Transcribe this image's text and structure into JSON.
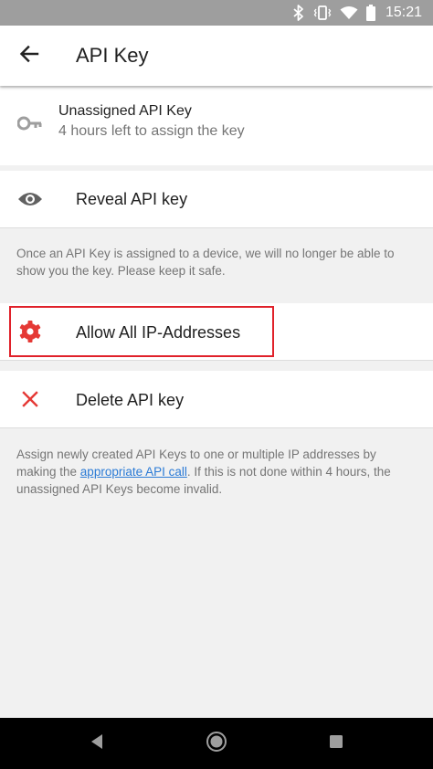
{
  "status_bar": {
    "time": "15:21",
    "icons": [
      "bluetooth-icon",
      "vibrate-icon",
      "wifi-icon",
      "battery-icon"
    ]
  },
  "app_bar": {
    "title": "API Key",
    "back_icon": "arrow-back-icon"
  },
  "key_info": {
    "title": "Unassigned API Key",
    "subtitle": "4 hours left to assign the key",
    "icon": "key-icon"
  },
  "reveal": {
    "label": "Reveal API key",
    "icon": "eye-icon"
  },
  "reveal_note": "Once an API Key is assigned to a device, we will no longer be able to show you the key. Please keep it safe.",
  "allow_ip": {
    "label": "Allow All IP-Addresses",
    "icon": "gear-icon"
  },
  "delete": {
    "label": "Delete API key",
    "icon": "close-icon"
  },
  "footer_note": {
    "before": "Assign newly created API Keys to one or multiple IP addresses by making the ",
    "link": "appropriate API call",
    "after": ". If this is not done within 4 hours, the unassigned API Keys become invalid."
  },
  "colors": {
    "accent_red": "#e53935",
    "link_blue": "#2b7bd6",
    "highlight_border": "#e0212a",
    "status_bar": "#9e9e9e",
    "background": "#f1f1f1"
  },
  "nav_bar": {
    "buttons": [
      "back-triangle-icon",
      "home-circle-icon",
      "recents-square-icon"
    ]
  }
}
